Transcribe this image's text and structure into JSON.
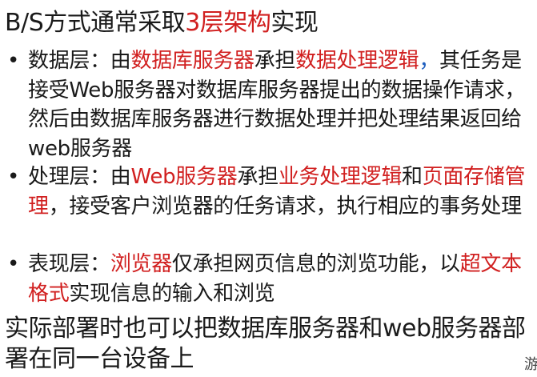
{
  "title": {
    "prefix": "B/S方式通常采取",
    "highlight": "3层架构",
    "suffix": "实现"
  },
  "bullets": [
    {
      "marker": "•",
      "segments": [
        {
          "text": "数据层：由",
          "color": "default"
        },
        {
          "text": "数据库服务器",
          "color": "red"
        },
        {
          "text": "承担",
          "color": "default"
        },
        {
          "text": "数据处理逻辑",
          "color": "red"
        },
        {
          "text": "，",
          "color": "blue"
        },
        {
          "text": "其任务是接受Web服务器对数据库服务器提出的数据操作请求，然后由数据库服务器进行数据处理并把处理结果返回给web服务器",
          "color": "default"
        }
      ]
    },
    {
      "marker": "•",
      "segments": [
        {
          "text": "处理层：由",
          "color": "default"
        },
        {
          "text": "Web服务器",
          "color": "red"
        },
        {
          "text": "承担",
          "color": "default"
        },
        {
          "text": "业务处理逻辑",
          "color": "red"
        },
        {
          "text": "和",
          "color": "default"
        },
        {
          "text": "页面存储管理",
          "color": "red"
        },
        {
          "text": "，接受客户浏览器的任务请求，执行相应的事务处理",
          "color": "default"
        }
      ]
    },
    {
      "marker": "•",
      "segments": [
        {
          "text": "表现层：",
          "color": "default"
        },
        {
          "text": "浏览器",
          "color": "red"
        },
        {
          "text": "仅承担网页信息的浏览功能，以",
          "color": "default"
        },
        {
          "text": "超文本格式",
          "color": "red"
        },
        {
          "text": "实现信息的输入和浏览",
          "color": "default"
        }
      ]
    }
  ],
  "footer": "实际部署时也可以把数据库服务器和web服务器部署在同一台设备上",
  "corner_glyph": "游",
  "colors": {
    "default": "#1a1a1a",
    "red": "#d12020",
    "blue": "#1f5fbf"
  }
}
